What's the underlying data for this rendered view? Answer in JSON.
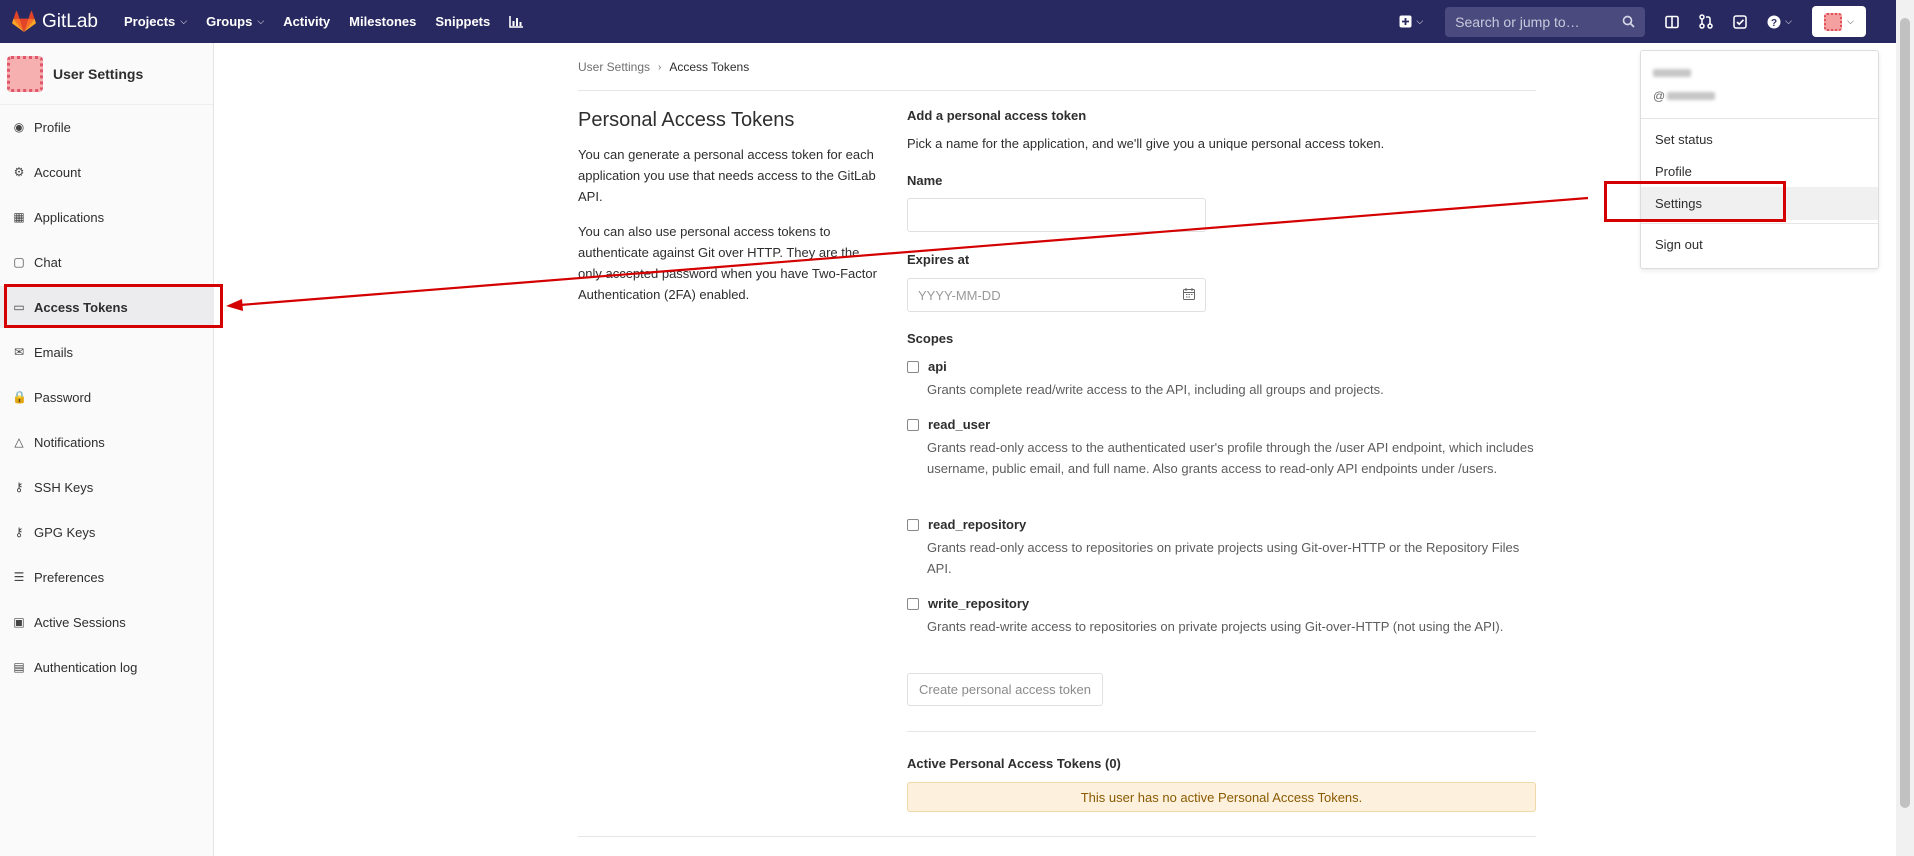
{
  "navbar": {
    "brand": "GitLab",
    "links": [
      {
        "label": "Projects",
        "caret": true
      },
      {
        "label": "Groups",
        "caret": true
      },
      {
        "label": "Activity",
        "caret": false
      },
      {
        "label": "Milestones",
        "caret": false
      },
      {
        "label": "Snippets",
        "caret": false
      }
    ],
    "search_placeholder": "Search or jump to…",
    "icons": [
      "plus-icon",
      "chart-icon",
      "sidebar-icon",
      "merge-request-icon",
      "todo-icon",
      "help-icon"
    ]
  },
  "sidebar": {
    "title": "User Settings",
    "items": [
      {
        "label": "Profile",
        "icon": "◉"
      },
      {
        "label": "Account",
        "icon": "⚙"
      },
      {
        "label": "Applications",
        "icon": "▦"
      },
      {
        "label": "Chat",
        "icon": "▢"
      },
      {
        "label": "Access Tokens",
        "icon": "▭"
      },
      {
        "label": "Emails",
        "icon": "✉"
      },
      {
        "label": "Password",
        "icon": "🔒"
      },
      {
        "label": "Notifications",
        "icon": "△"
      },
      {
        "label": "SSH Keys",
        "icon": "⚷"
      },
      {
        "label": "GPG Keys",
        "icon": "⚷"
      },
      {
        "label": "Preferences",
        "icon": "☰"
      },
      {
        "label": "Active Sessions",
        "icon": "▣"
      },
      {
        "label": "Authentication log",
        "icon": "▤"
      }
    ],
    "active": "Access Tokens"
  },
  "breadcrumb": {
    "parent": "User Settings",
    "current": "Access Tokens"
  },
  "intro": {
    "title": "Personal Access Tokens",
    "p1": "You can generate a personal access token for each application you use that needs access to the GitLab API.",
    "p2": "You can also use personal access tokens to authenticate against Git over HTTP. They are the only accepted password when you have Two-Factor Authentication (2FA) enabled."
  },
  "form": {
    "heading": "Add a personal access token",
    "help": "Pick a name for the application, and we'll give you a unique personal access token.",
    "name_label": "Name",
    "name_value": "",
    "expires_label": "Expires at",
    "expires_placeholder": "YYYY-MM-DD",
    "scopes_label": "Scopes",
    "scopes": [
      {
        "name": "api",
        "desc": "Grants complete read/write access to the API, including all groups and projects.",
        "checked": false
      },
      {
        "name": "read_user",
        "desc": "Grants read-only access to the authenticated user's profile through the /user API endpoint, which includes username, public email, and full name. Also grants access to read-only API endpoints under /users.",
        "checked": false
      },
      {
        "name": "read_repository",
        "desc": "Grants read-only access to repositories on private projects using Git-over-HTTP or the Repository Files API.",
        "checked": false
      },
      {
        "name": "write_repository",
        "desc": "Grants read-write access to repositories on private projects using Git-over-HTTP (not using the API).",
        "checked": false
      }
    ],
    "create_button": "Create personal access token"
  },
  "active_tokens": {
    "title": "Active Personal Access Tokens (0)",
    "empty_message": "This user has no active Personal Access Tokens."
  },
  "user_menu": {
    "handle_prefix": "@",
    "items": [
      "Set status",
      "Profile",
      "Settings",
      "Sign out"
    ],
    "highlighted": "Settings"
  },
  "colors": {
    "navbar": "#292961",
    "annotation": "#d40000",
    "warning_bg": "#fdf1dd"
  }
}
